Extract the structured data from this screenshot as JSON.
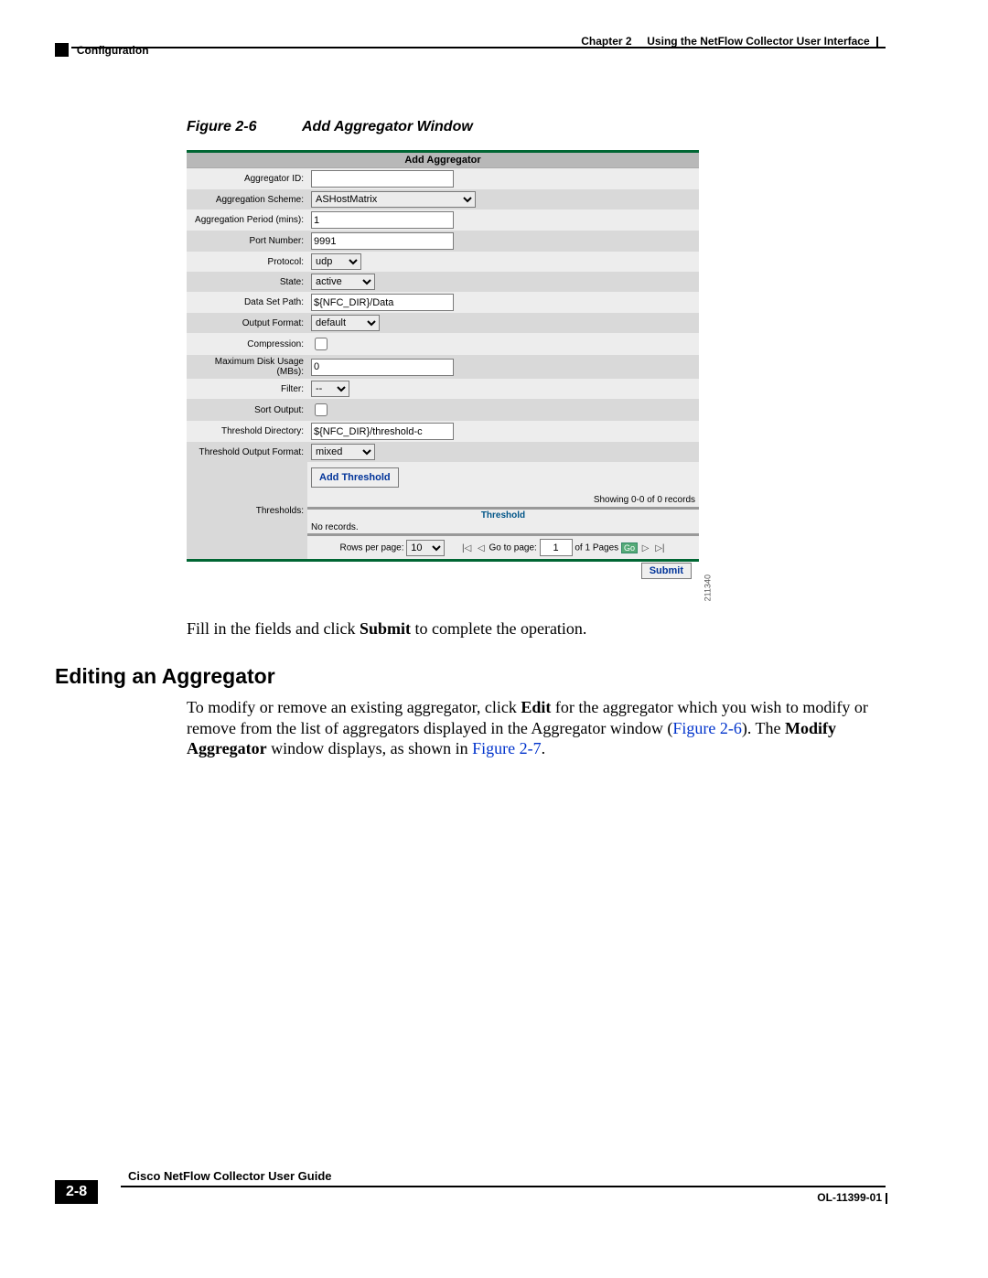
{
  "header": {
    "left_section": "Configuration",
    "right_chapter": "Chapter 2",
    "right_title": "Using the NetFlow Collector User Interface"
  },
  "figure": {
    "label": "Figure 2-6",
    "title": "Add Aggregator Window"
  },
  "screenshot": {
    "panel_title": "Add Aggregator",
    "image_id": "211340",
    "fields": {
      "aggregator_id": {
        "label": "Aggregator ID:",
        "value": ""
      },
      "aggregation_scheme": {
        "label": "Aggregation Scheme:",
        "value": "ASHostMatrix"
      },
      "aggregation_period": {
        "label": "Aggregation Period (mins):",
        "value": "1"
      },
      "port_number": {
        "label": "Port Number:",
        "value": "9991"
      },
      "protocol": {
        "label": "Protocol:",
        "value": "udp"
      },
      "state": {
        "label": "State:",
        "value": "active"
      },
      "data_set_path": {
        "label": "Data Set Path:",
        "value": "${NFC_DIR}/Data"
      },
      "output_format": {
        "label": "Output Format:",
        "value": "default"
      },
      "compression": {
        "label": "Compression:"
      },
      "max_disk_usage": {
        "label": "Maximum Disk Usage (MBs):",
        "value": "0"
      },
      "filter": {
        "label": "Filter:",
        "value": "--"
      },
      "sort_output": {
        "label": "Sort Output:"
      },
      "threshold_directory": {
        "label": "Threshold Directory:",
        "value": "${NFC_DIR}/threshold-c"
      },
      "threshold_output_format": {
        "label": "Threshold Output Format:",
        "value": "mixed"
      },
      "thresholds": {
        "label": "Thresholds:"
      }
    },
    "threshold_panel": {
      "add_button": "Add Threshold",
      "count_text": "Showing 0-0 of 0 records",
      "column_header": "Threshold",
      "no_records": "No records.",
      "pager": {
        "rows_label": "Rows per page:",
        "rows_value": "10",
        "goto_label": "Go to page:",
        "goto_value": "1",
        "of_pages": "of 1 Pages",
        "go": "Go"
      }
    },
    "submit": "Submit"
  },
  "text": {
    "fill_pre": "Fill in the fields and click ",
    "fill_bold": "Submit",
    "fill_post": " to complete the operation.",
    "edit_heading": "Editing an Aggregator",
    "edit_p1a": "To modify or remove an existing aggregator, click ",
    "edit_p1b": "Edit",
    "edit_p1c": " for the aggregator which you wish to modify or remove from the list of aggregators displayed in the Aggregator window (",
    "edit_link1": "Figure 2-6",
    "edit_p1d": "). The ",
    "edit_p1e": "Modify Aggregator",
    "edit_p1f": " window displays, as shown in ",
    "edit_link2": "Figure 2-7",
    "edit_p1g": "."
  },
  "footer": {
    "guide": "Cisco NetFlow Collector User Guide",
    "page": "2-8",
    "doc_id": "OL-11399-01"
  }
}
